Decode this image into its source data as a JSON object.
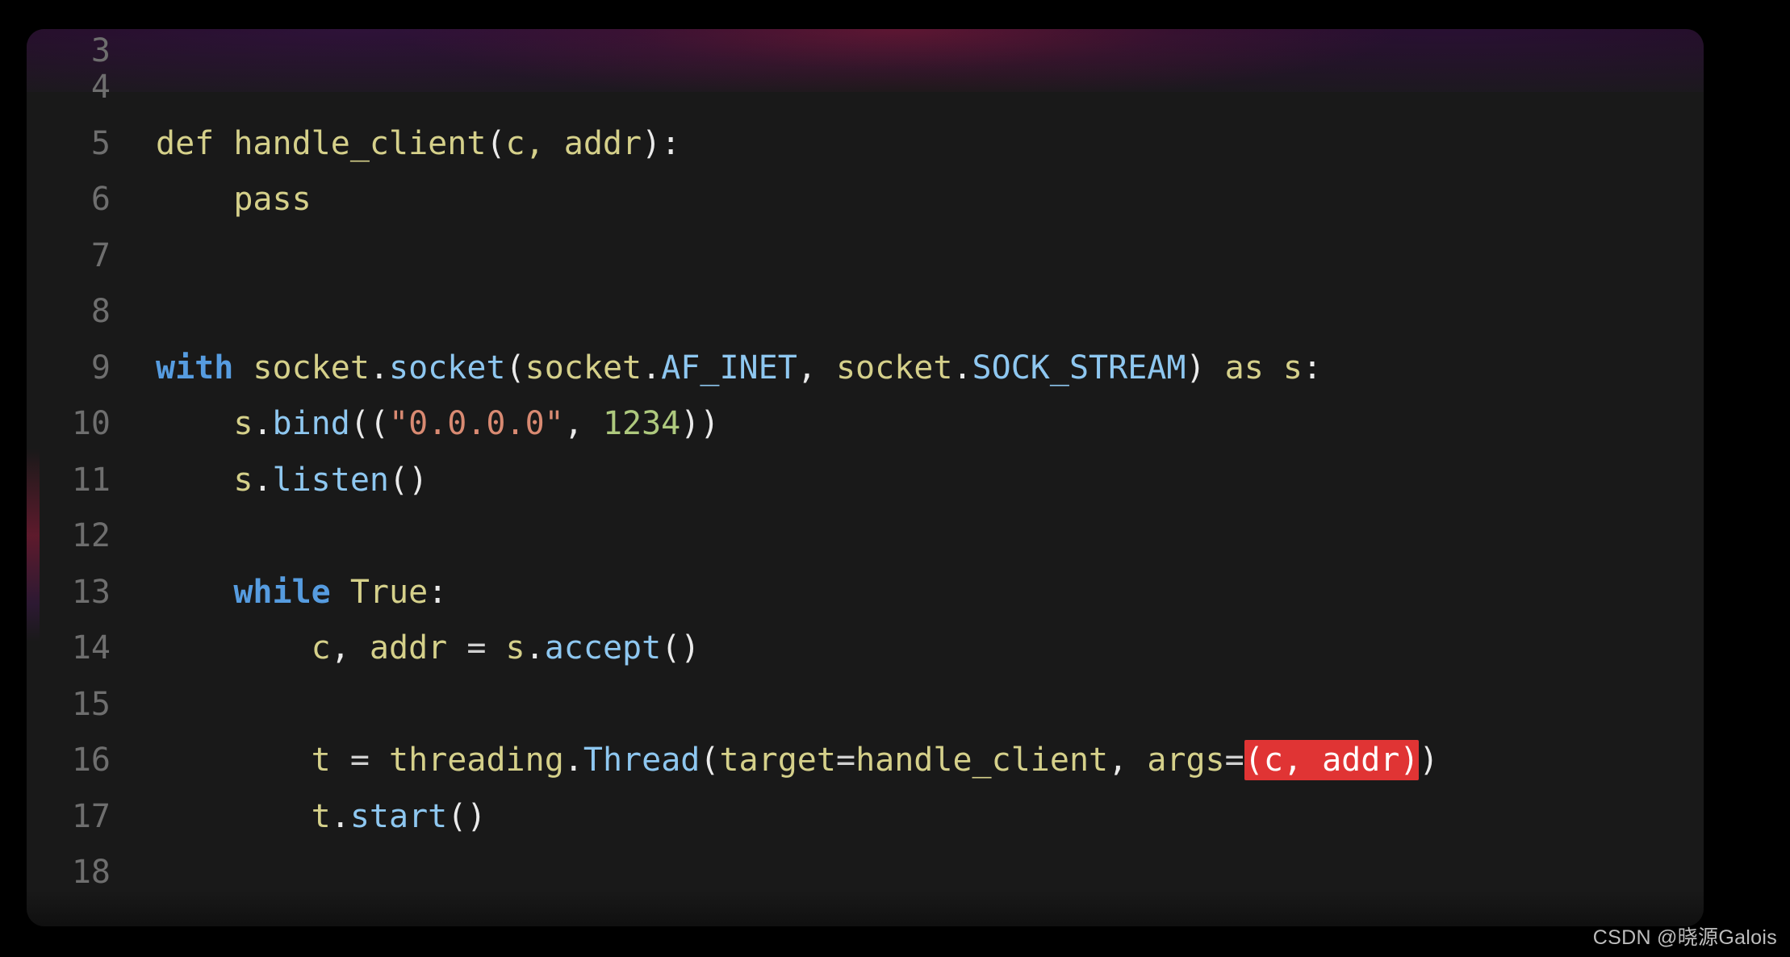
{
  "app": {
    "kind": "code-editor-snippet",
    "language": "Python",
    "background_color": "#000000",
    "panel_color": "#191919",
    "gutter_color": "#6e6e6e",
    "highlight_color": "#e03434",
    "highlight_text_color": "#ffffff"
  },
  "watermark": {
    "text": "CSDN @晓源Galois"
  },
  "editor": {
    "first_visible_line": 3,
    "last_visible_line": 18,
    "lines": [
      {
        "number": "3",
        "clipped": true,
        "tokens": []
      },
      {
        "number": "4",
        "tokens": []
      },
      {
        "number": "5",
        "tokens": [
          {
            "text": "def handle_client",
            "cls": "t-ident"
          },
          {
            "text": "(",
            "cls": "t-punct"
          },
          {
            "text": "c, addr",
            "cls": "t-ident"
          },
          {
            "text": "):",
            "cls": "t-punct"
          }
        ]
      },
      {
        "number": "6",
        "tokens": [
          {
            "text": "    pass",
            "cls": "t-ident"
          }
        ]
      },
      {
        "number": "7",
        "tokens": []
      },
      {
        "number": "8",
        "tokens": []
      },
      {
        "number": "9",
        "tokens": [
          {
            "text": "with",
            "cls": "t-kw"
          },
          {
            "text": " ",
            "cls": "t-plain"
          },
          {
            "text": "socket",
            "cls": "t-ident"
          },
          {
            "text": ".",
            "cls": "t-punct"
          },
          {
            "text": "socket",
            "cls": "t-fn"
          },
          {
            "text": "(",
            "cls": "t-punct"
          },
          {
            "text": "socket",
            "cls": "t-ident"
          },
          {
            "text": ".",
            "cls": "t-punct"
          },
          {
            "text": "AF_INET",
            "cls": "t-attr"
          },
          {
            "text": ", ",
            "cls": "t-punct"
          },
          {
            "text": "socket",
            "cls": "t-ident"
          },
          {
            "text": ".",
            "cls": "t-punct"
          },
          {
            "text": "SOCK_STREAM",
            "cls": "t-attr"
          },
          {
            "text": ")",
            "cls": "t-punct"
          },
          {
            "text": " ",
            "cls": "t-plain"
          },
          {
            "text": "as",
            "cls": "t-ident"
          },
          {
            "text": " ",
            "cls": "t-plain"
          },
          {
            "text": "s",
            "cls": "t-ident"
          },
          {
            "text": ":",
            "cls": "t-punct"
          }
        ]
      },
      {
        "number": "10",
        "tokens": [
          {
            "text": "    s",
            "cls": "t-ident"
          },
          {
            "text": ".",
            "cls": "t-punct"
          },
          {
            "text": "bind",
            "cls": "t-fn"
          },
          {
            "text": "((",
            "cls": "t-punct"
          },
          {
            "text": "\"0.0.0.0\"",
            "cls": "t-str"
          },
          {
            "text": ", ",
            "cls": "t-punct"
          },
          {
            "text": "1234",
            "cls": "t-num"
          },
          {
            "text": "))",
            "cls": "t-punct"
          }
        ]
      },
      {
        "number": "11",
        "tokens": [
          {
            "text": "    s",
            "cls": "t-ident"
          },
          {
            "text": ".",
            "cls": "t-punct"
          },
          {
            "text": "listen",
            "cls": "t-fn"
          },
          {
            "text": "()",
            "cls": "t-punct"
          }
        ]
      },
      {
        "number": "12",
        "tokens": []
      },
      {
        "number": "13",
        "tokens": [
          {
            "text": "    ",
            "cls": "t-plain"
          },
          {
            "text": "while",
            "cls": "t-kw"
          },
          {
            "text": " ",
            "cls": "t-plain"
          },
          {
            "text": "True",
            "cls": "t-ident"
          },
          {
            "text": ":",
            "cls": "t-punct"
          }
        ]
      },
      {
        "number": "14",
        "tokens": [
          {
            "text": "        c",
            "cls": "t-ident"
          },
          {
            "text": ", ",
            "cls": "t-punct"
          },
          {
            "text": "addr",
            "cls": "t-ident"
          },
          {
            "text": " ",
            "cls": "t-plain"
          },
          {
            "text": "=",
            "cls": "t-op"
          },
          {
            "text": " ",
            "cls": "t-plain"
          },
          {
            "text": "s",
            "cls": "t-ident"
          },
          {
            "text": ".",
            "cls": "t-punct"
          },
          {
            "text": "accept",
            "cls": "t-fn"
          },
          {
            "text": "()",
            "cls": "t-punct"
          }
        ]
      },
      {
        "number": "15",
        "tokens": []
      },
      {
        "number": "16",
        "tokens": [
          {
            "text": "        t",
            "cls": "t-ident"
          },
          {
            "text": " ",
            "cls": "t-plain"
          },
          {
            "text": "=",
            "cls": "t-op"
          },
          {
            "text": " ",
            "cls": "t-plain"
          },
          {
            "text": "threading",
            "cls": "t-ident"
          },
          {
            "text": ".",
            "cls": "t-punct"
          },
          {
            "text": "Thread",
            "cls": "t-fn"
          },
          {
            "text": "(",
            "cls": "t-punct"
          },
          {
            "text": "target",
            "cls": "t-ident"
          },
          {
            "text": "=",
            "cls": "t-op"
          },
          {
            "text": "handle_client",
            "cls": "t-ident"
          },
          {
            "text": ", ",
            "cls": "t-punct"
          },
          {
            "text": "args",
            "cls": "t-ident"
          },
          {
            "text": "=",
            "cls": "t-op"
          },
          {
            "text": "(c, addr)",
            "cls": "t-plain",
            "highlight": true
          },
          {
            "text": ")",
            "cls": "t-punct"
          }
        ]
      },
      {
        "number": "17",
        "tokens": [
          {
            "text": "        t",
            "cls": "t-ident"
          },
          {
            "text": ".",
            "cls": "t-punct"
          },
          {
            "text": "start",
            "cls": "t-fn"
          },
          {
            "text": "()",
            "cls": "t-punct"
          }
        ]
      },
      {
        "number": "18",
        "tokens": []
      }
    ]
  }
}
